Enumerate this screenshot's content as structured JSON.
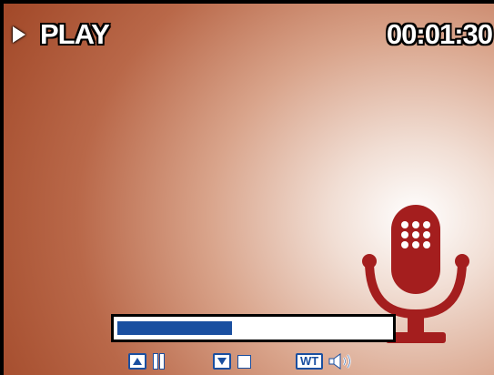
{
  "status": {
    "mode_label": "PLAY",
    "elapsed_time": "00:01:30"
  },
  "playback": {
    "progress_fraction": 0.42
  },
  "controls": {
    "pause": {
      "key_icon": "up-arrow-key-icon",
      "action_icon": "pause-icon"
    },
    "stop": {
      "key_icon": "down-arrow-key-icon",
      "action_icon": "stop-icon"
    },
    "volume": {
      "key_label": "WT",
      "action_icon": "speaker-volume-icon"
    }
  },
  "indicators": {
    "recording_icon": "microphone-icon"
  },
  "colors": {
    "icon_red": "#a41e1e",
    "control_blue": "#1a4fa0",
    "osd_text": "#ffffff"
  }
}
